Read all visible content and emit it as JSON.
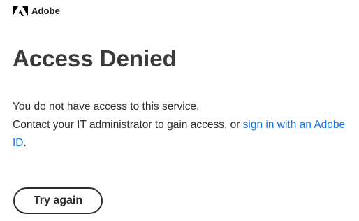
{
  "brand": {
    "name": "Adobe",
    "logo_icon": "adobe-logo-icon",
    "logo_color": "#000000"
  },
  "page": {
    "title": "Access Denied",
    "message_line1": "You do not have access to this service.",
    "message_line2_prefix": "Contact your IT administrator to gain access, or ",
    "signin_link": "sign in with an Adobe ID",
    "message_line2_suffix": ".",
    "link_color": "#1473e6"
  },
  "actions": {
    "try_again_label": "Try again"
  }
}
